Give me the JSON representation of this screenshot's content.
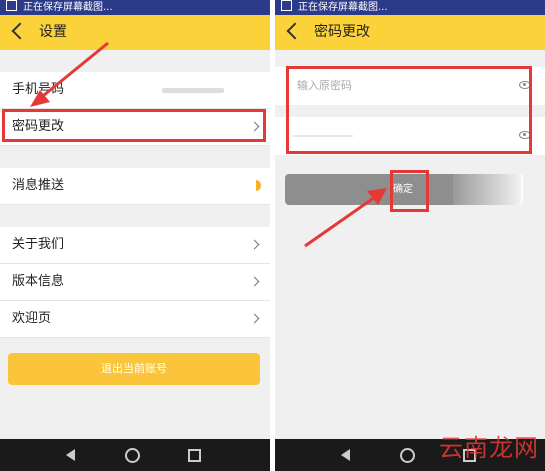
{
  "left_screen": {
    "status_bar": {
      "text": "正在保存屏幕截图..."
    },
    "header": {
      "title": "设置"
    },
    "rows": [
      {
        "label": "手机号码"
      },
      {
        "label": "密码更改"
      },
      {
        "label": "消息推送"
      },
      {
        "label": "关于我们"
      },
      {
        "label": "版本信息"
      },
      {
        "label": "欢迎页"
      }
    ],
    "logout_label": "退出当前账号"
  },
  "right_screen": {
    "status_bar": {
      "text": "正在保存屏幕截图..."
    },
    "header": {
      "title": "密码更改"
    },
    "old_password_placeholder": "输入原密码",
    "new_password_placeholder": "",
    "confirm_label": "确定"
  },
  "watermark": "云南龙网",
  "colors": {
    "accent_yellow": "#fbd23a",
    "highlight_red": "#e53935",
    "status_bar_blue": "#2c3a8a"
  }
}
